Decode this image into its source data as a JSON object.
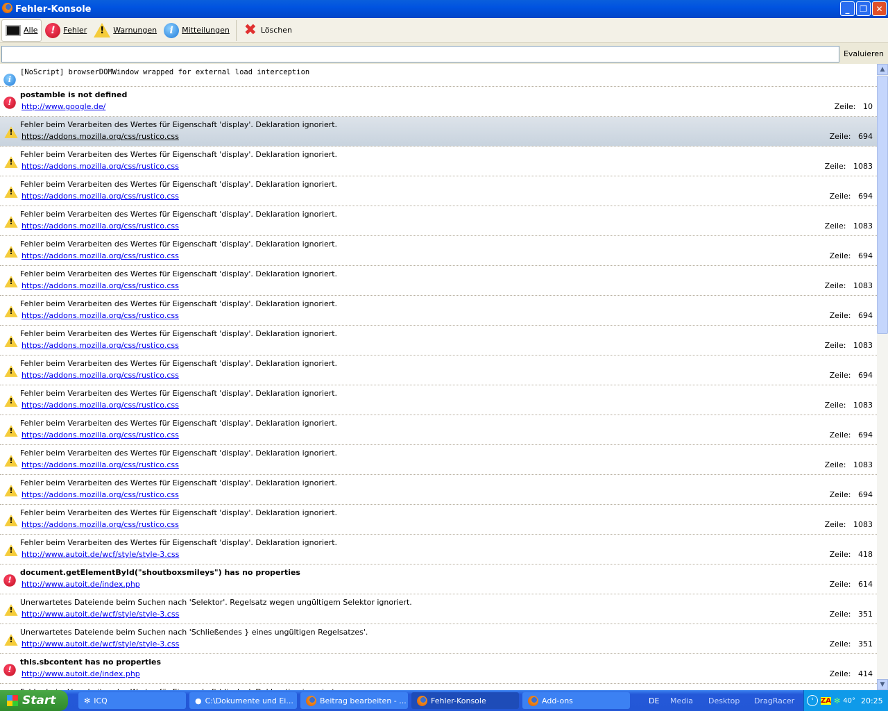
{
  "window": {
    "title": "Fehler-Konsole",
    "icon": "firefox-icon"
  },
  "toolbar": {
    "all": "Alle",
    "errors": "Fehler",
    "warnings": "Warnungen",
    "messages": "Mitteilungen",
    "clear": "Löschen"
  },
  "eval": {
    "value": "",
    "button": "Evaluieren"
  },
  "line_label": "Zeile:",
  "entries": [
    {
      "type": "info",
      "message": "[NoScript] browserDOMWindow wrapped for external load interception"
    },
    {
      "type": "error",
      "message": "postamble is not defined",
      "source": "http://www.google.de/",
      "line": "10"
    },
    {
      "type": "warning",
      "message": "Fehler beim Verarbeiten des Wertes für Eigenschaft 'display'. Deklaration ignoriert.",
      "source": "https://addons.mozilla.org/css/rustico.css",
      "line": "694",
      "selected": true
    },
    {
      "type": "warning",
      "message": "Fehler beim Verarbeiten des Wertes für Eigenschaft 'display'. Deklaration ignoriert.",
      "source": "https://addons.mozilla.org/css/rustico.css",
      "line": "1083"
    },
    {
      "type": "warning",
      "message": "Fehler beim Verarbeiten des Wertes für Eigenschaft 'display'. Deklaration ignoriert.",
      "source": "https://addons.mozilla.org/css/rustico.css",
      "line": "694"
    },
    {
      "type": "warning",
      "message": "Fehler beim Verarbeiten des Wertes für Eigenschaft 'display'. Deklaration ignoriert.",
      "source": "https://addons.mozilla.org/css/rustico.css",
      "line": "1083"
    },
    {
      "type": "warning",
      "message": "Fehler beim Verarbeiten des Wertes für Eigenschaft 'display'. Deklaration ignoriert.",
      "source": "https://addons.mozilla.org/css/rustico.css",
      "line": "694"
    },
    {
      "type": "warning",
      "message": "Fehler beim Verarbeiten des Wertes für Eigenschaft 'display'. Deklaration ignoriert.",
      "source": "https://addons.mozilla.org/css/rustico.css",
      "line": "1083"
    },
    {
      "type": "warning",
      "message": "Fehler beim Verarbeiten des Wertes für Eigenschaft 'display'. Deklaration ignoriert.",
      "source": "https://addons.mozilla.org/css/rustico.css",
      "line": "694"
    },
    {
      "type": "warning",
      "message": "Fehler beim Verarbeiten des Wertes für Eigenschaft 'display'. Deklaration ignoriert.",
      "source": "https://addons.mozilla.org/css/rustico.css",
      "line": "1083"
    },
    {
      "type": "warning",
      "message": "Fehler beim Verarbeiten des Wertes für Eigenschaft 'display'. Deklaration ignoriert.",
      "source": "https://addons.mozilla.org/css/rustico.css",
      "line": "694"
    },
    {
      "type": "warning",
      "message": "Fehler beim Verarbeiten des Wertes für Eigenschaft 'display'. Deklaration ignoriert.",
      "source": "https://addons.mozilla.org/css/rustico.css",
      "line": "1083"
    },
    {
      "type": "warning",
      "message": "Fehler beim Verarbeiten des Wertes für Eigenschaft 'display'. Deklaration ignoriert.",
      "source": "https://addons.mozilla.org/css/rustico.css",
      "line": "694"
    },
    {
      "type": "warning",
      "message": "Fehler beim Verarbeiten des Wertes für Eigenschaft 'display'. Deklaration ignoriert.",
      "source": "https://addons.mozilla.org/css/rustico.css",
      "line": "1083"
    },
    {
      "type": "warning",
      "message": "Fehler beim Verarbeiten des Wertes für Eigenschaft 'display'. Deklaration ignoriert.",
      "source": "https://addons.mozilla.org/css/rustico.css",
      "line": "694"
    },
    {
      "type": "warning",
      "message": "Fehler beim Verarbeiten des Wertes für Eigenschaft 'display'. Deklaration ignoriert.",
      "source": "https://addons.mozilla.org/css/rustico.css",
      "line": "1083"
    },
    {
      "type": "warning",
      "message": "Fehler beim Verarbeiten des Wertes für Eigenschaft 'display'. Deklaration ignoriert.",
      "source": "http://www.autoit.de/wcf/style/style-3.css",
      "line": "418"
    },
    {
      "type": "error",
      "message": "document.getElementById(\"shoutboxsmileys\") has no properties",
      "source": "http://www.autoit.de/index.php",
      "line": "614"
    },
    {
      "type": "warning",
      "message": "Unerwartetes Dateiende beim Suchen nach 'Selektor'. Regelsatz wegen ungültigem Selektor ignoriert.",
      "source": "http://www.autoit.de/wcf/style/style-3.css",
      "line": "351"
    },
    {
      "type": "warning",
      "message": "Unerwartetes Dateiende beim Suchen nach 'Schließendes } eines ungültigen Regelsatzes'.",
      "source": "http://www.autoit.de/wcf/style/style-3.css",
      "line": "351"
    },
    {
      "type": "error",
      "message": "this.sbcontent has no properties",
      "source": "http://www.autoit.de/index.php",
      "line": "414"
    },
    {
      "type": "warning",
      "message": "Fehler beim Verarbeiten des Wertes für Eigenschaft 'display'. Deklaration ignoriert."
    }
  ],
  "taskbar": {
    "start": "Start",
    "tasks": [
      {
        "label": "ICQ",
        "icon": "icq-icon"
      },
      {
        "label": "C:\\Dokumente und Ei...",
        "icon": "folder-icon"
      },
      {
        "label": "Beitrag bearbeiten - ...",
        "icon": "firefox-icon"
      },
      {
        "label": "Fehler-Konsole",
        "icon": "firefox-icon",
        "active": true
      },
      {
        "label": "Add-ons",
        "icon": "firefox-icon"
      }
    ],
    "language": "DE",
    "toolbars": [
      "Media",
      "Desktop",
      "DragRacer"
    ],
    "tray_temp": "40°",
    "clock": "20:25"
  }
}
